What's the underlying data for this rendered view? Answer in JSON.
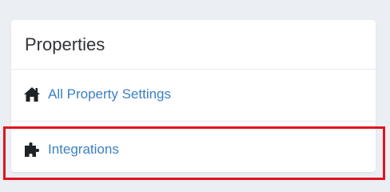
{
  "panel": {
    "title": "Properties",
    "items": [
      {
        "label": "All Property Settings",
        "icon": "home-icon"
      },
      {
        "label": "Integrations",
        "icon": "puzzle-piece-icon"
      }
    ]
  },
  "colors": {
    "background": "#ebeef3",
    "panel": "#ffffff",
    "title_text": "#2f3438",
    "link": "#3b7fc4",
    "icon": "#1f2326",
    "highlight_border": "#e0151f"
  }
}
